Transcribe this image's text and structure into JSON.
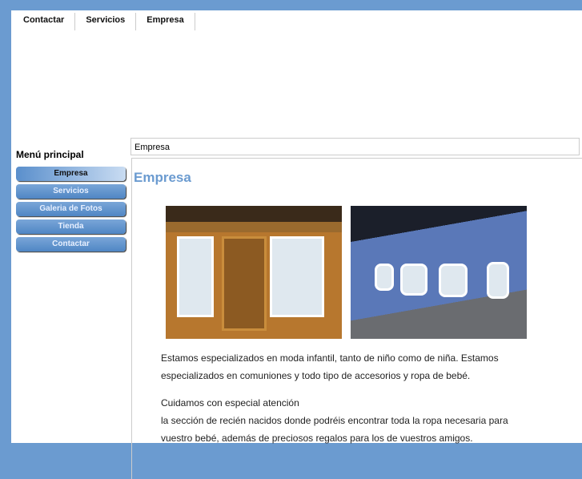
{
  "topnav": [
    "Contactar",
    "Servicios",
    "Empresa"
  ],
  "sidebar": {
    "title": "Menú principal",
    "items": [
      "Empresa",
      "Servicios",
      "Galeria de Fotos",
      "Tienda",
      "Contactar"
    ]
  },
  "breadcrumb": "Empresa",
  "content": {
    "title": "Empresa",
    "p1": "Estamos especializados en moda infantil, tanto de niño como de niña. Estamos especializados en comuniones y todo tipo de accesorios y ropa de bebé.",
    "p2a": "Cuidamos con especial atención",
    "p2b": "la sección de recién nacidos donde podréis encontrar toda la ropa necesaria para vuestro bebé, además de preciosos regalos para los de vuestros amigos."
  },
  "colors": {
    "accent": "#6b9bd0"
  }
}
